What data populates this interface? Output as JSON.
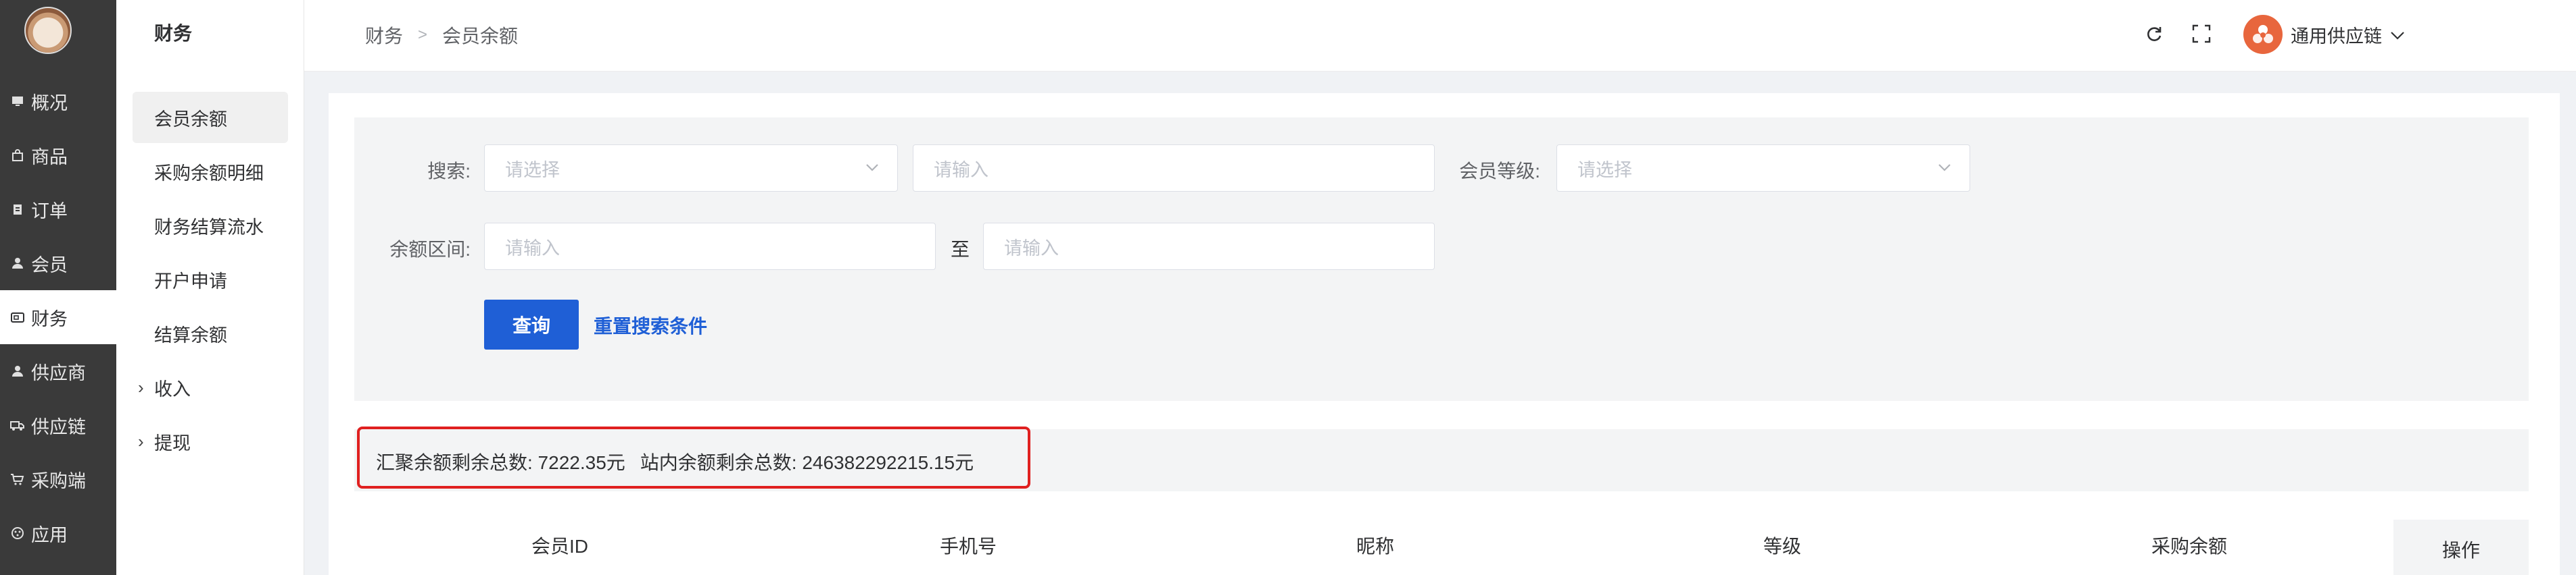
{
  "nav": {
    "items": [
      {
        "label": "概况",
        "icon": "monitor-icon"
      },
      {
        "label": "商品",
        "icon": "bag-icon"
      },
      {
        "label": "订单",
        "icon": "clipboard-icon"
      },
      {
        "label": "会员",
        "icon": "user-icon"
      },
      {
        "label": "财务",
        "icon": "wallet-icon",
        "active": true
      },
      {
        "label": "供应商",
        "icon": "user-icon"
      },
      {
        "label": "供应链",
        "icon": "truck-icon"
      },
      {
        "label": "采购端",
        "icon": "cart-icon"
      },
      {
        "label": "应用",
        "icon": "apps-icon"
      }
    ]
  },
  "sidebar": {
    "title": "财务",
    "items": [
      {
        "label": "会员余额",
        "active": true
      },
      {
        "label": "采购余额明细"
      },
      {
        "label": "财务结算流水"
      },
      {
        "label": "开户申请"
      },
      {
        "label": "结算余额"
      },
      {
        "label": "收入",
        "group": true
      },
      {
        "label": "提现",
        "group": true
      }
    ]
  },
  "header": {
    "breadcrumb": [
      "财务",
      "会员余额"
    ],
    "org_name": "通用供应链",
    "icons": [
      "refresh-icon",
      "fullscreen-icon",
      "chevron-down-icon"
    ]
  },
  "search": {
    "search_label": "搜索:",
    "search_select_placeholder": "请选择",
    "search_input_placeholder": "请输入",
    "level_label": "会员等级:",
    "level_select_placeholder": "请选择",
    "range_label": "余额区间:",
    "range_min_placeholder": "请输入",
    "range_to": "至",
    "range_max_placeholder": "请输入",
    "query_button": "查询",
    "reset_link": "重置搜索条件"
  },
  "summary": {
    "huiju": "汇聚余额剩余总数: 7222.35元",
    "zhannei": "站内余额剩余总数: 246382292215.15元"
  },
  "table": {
    "columns": [
      "会员ID",
      "手机号",
      "昵称",
      "等级",
      "采购余额",
      "操作"
    ]
  },
  "colors": {
    "nav_bg": "#3a3a3a",
    "primary": "#1f5fd6",
    "highlight_border": "#e02020",
    "org_logo": "#e8663d"
  }
}
